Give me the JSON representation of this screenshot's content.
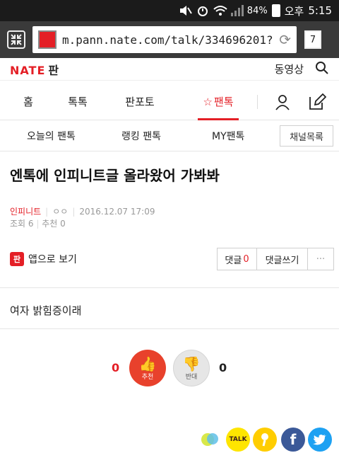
{
  "status_bar": {
    "battery": "84%",
    "ampm": "오후",
    "time": "5:15"
  },
  "browser": {
    "url": "m.pann.nate.com/talk/334696201?",
    "tab_count": "7"
  },
  "header": {
    "logo": "NATE",
    "logo_sub": "판",
    "video_link": "동영상"
  },
  "gnb": [
    {
      "label": "홈"
    },
    {
      "label": "톡톡"
    },
    {
      "label": "판포토"
    },
    {
      "label": "팬톡"
    }
  ],
  "subnav": [
    {
      "label": "오늘의 팬톡"
    },
    {
      "label": "랭킹 팬톡"
    },
    {
      "label": "MY팬톡"
    }
  ],
  "channel_button": "채널목록",
  "post": {
    "title": "엔톡에 인피니트글 올라왔어 가봐봐",
    "author": "인피니트",
    "author_id": "ㅇㅇ",
    "date": "2016.12.07 17:09",
    "views": "조회 6",
    "recommends": "추천 0",
    "content": "여자 밝힘증이래"
  },
  "app_view": {
    "badge": "판",
    "label": "앱으로 보기"
  },
  "comment_buttons": {
    "comments_label": "댓글",
    "comments_count": "0",
    "write": "댓글쓰기",
    "more": "···"
  },
  "vote": {
    "up_count": "0",
    "up_label": "추천",
    "down_label": "반대",
    "down_count": "0"
  },
  "share": [
    {
      "name": "talk-icon",
      "label": ""
    },
    {
      "name": "kakaotalk-icon",
      "label": "TALK"
    },
    {
      "name": "kakaostory-icon",
      "label": ""
    },
    {
      "name": "facebook-icon",
      "label": "f"
    },
    {
      "name": "twitter-icon",
      "label": ""
    }
  ],
  "colors": {
    "brand": "#e41f26",
    "status_bg": "#1b1b1b",
    "urlbar_bg": "#3a3a3a"
  }
}
